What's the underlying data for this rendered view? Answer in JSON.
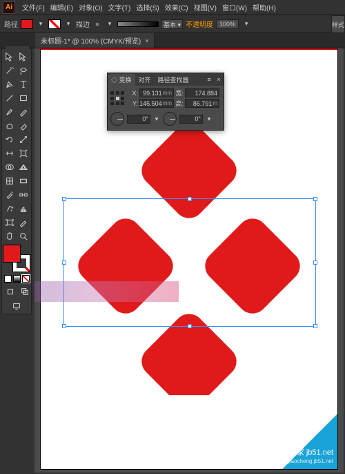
{
  "menubar": {
    "items": [
      "文件(F)",
      "编辑(E)",
      "对象(O)",
      "文字(T)",
      "选择(S)",
      "效果(C)",
      "视图(V)",
      "窗口(W)",
      "帮助(H)"
    ]
  },
  "optbar": {
    "label": "路径",
    "stroke": "描边",
    "stroke_weight_label": "基本",
    "opacity_label": "不透明度",
    "opacity_value": "100%",
    "flyout": "样式"
  },
  "tab": {
    "title": "未标题-1* @ 100% (CMYK/预览)",
    "close": "×"
  },
  "panel": {
    "tabs": [
      "变换",
      "对齐",
      "路径查找器"
    ],
    "x_label": "X:",
    "x_value": "99.131",
    "x_unit": "mm",
    "w_label": "宽:",
    "w_value": "174.884",
    "y_label": "Y:",
    "y_value": "145.504",
    "y_unit": "mm",
    "h_label": "高:",
    "h_value": "86.791",
    "h_unit": "m",
    "rot_value": "0°",
    "shear_value": "0°",
    "collapse": "≡",
    "close": "×"
  },
  "colors": {
    "fill": "#e01a1a",
    "accent": "#3b8cff"
  },
  "watermark": {
    "line1": "脚本之家 jb51.net",
    "line2": "jiaocheng.jb51.net"
  }
}
